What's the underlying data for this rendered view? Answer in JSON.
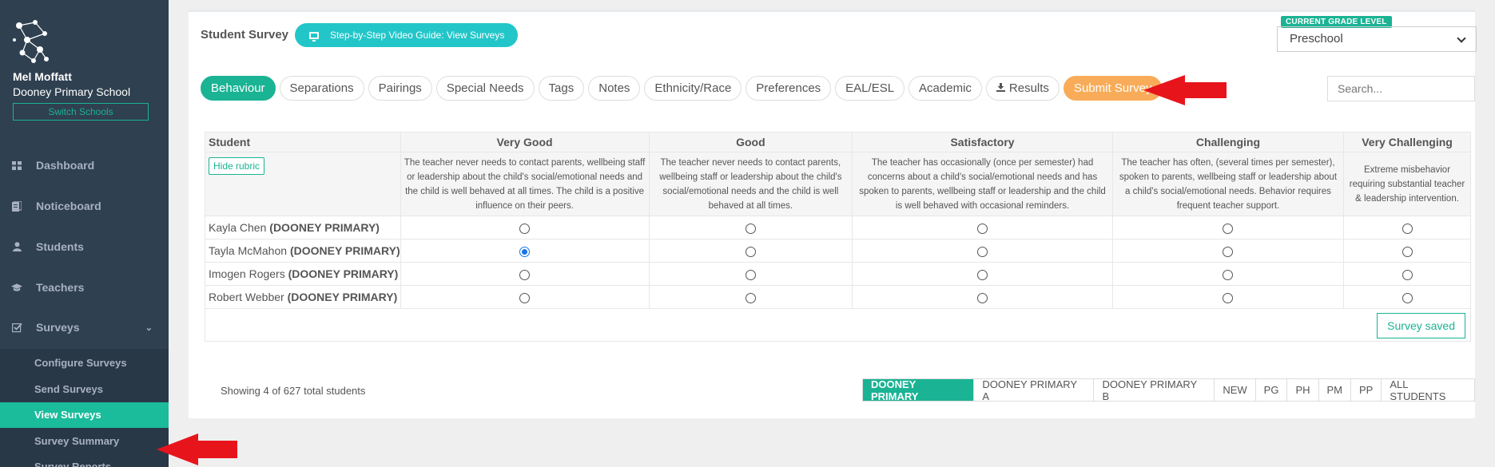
{
  "sidebar": {
    "user_name": "Mel Moffatt",
    "school_name": "Dooney Primary School",
    "switch_label": "Switch Schools",
    "nav": [
      {
        "label": "Dashboard",
        "icon": "dashboard-icon"
      },
      {
        "label": "Noticeboard",
        "icon": "noticeboard-icon"
      },
      {
        "label": "Students",
        "icon": "user-icon"
      },
      {
        "label": "Teachers",
        "icon": "graduation-cap-icon"
      },
      {
        "label": "Surveys",
        "icon": "checkbox-icon"
      }
    ],
    "sub_nav": [
      {
        "label": "Configure Surveys"
      },
      {
        "label": "Send Surveys"
      },
      {
        "label": "View Surveys"
      },
      {
        "label": "Survey Summary"
      },
      {
        "label": "Survey Reports"
      }
    ]
  },
  "header": {
    "title": "Student Survey",
    "guide_label": "Step-by-Step Video Guide: View Surveys",
    "grade_badge": "CURRENT GRADE LEVEL",
    "grade_value": "Preschool"
  },
  "tabs": [
    "Behaviour",
    "Separations",
    "Pairings",
    "Special Needs",
    "Tags",
    "Notes",
    "Ethnicity/Race",
    "Preferences",
    "EAL/ESL",
    "Academic",
    "Results",
    "Submit Survey"
  ],
  "search": {
    "placeholder": "Search..."
  },
  "table": {
    "columns": [
      "Student",
      "Very Good",
      "Good",
      "Satisfactory",
      "Challenging",
      "Very Challenging"
    ],
    "hide_rubric_label": "Hide rubric",
    "rubric": [
      "The teacher never needs to contact parents, wellbeing staff or leadership about the child's social/emotional needs and the child is well behaved at all times. The child is a positive influence on their peers.",
      "The teacher never needs to contact parents, wellbeing staff or leadership about the child's social/emotional needs and the child is well behaved at all times.",
      "The teacher has occasionally (once per semester) had concerns about a child's social/emotional needs and has spoken to parents, wellbeing staff or leadership and the child is well behaved with occasional reminders.",
      "The teacher has often, (several times per semester), spoken to parents, wellbeing staff or leadership about a child's social/emotional needs. Behavior requires frequent teacher support.",
      "Extreme misbehavior requiring substantial teacher & leadership intervention."
    ],
    "rows": [
      {
        "name": "Kayla Chen",
        "school": "(DOONEY PRIMARY)",
        "selected": null
      },
      {
        "name": "Tayla McMahon",
        "school": "(DOONEY PRIMARY)",
        "selected": 0
      },
      {
        "name": "Imogen Rogers",
        "school": "(DOONEY PRIMARY)",
        "selected": null
      },
      {
        "name": "Robert Webber",
        "school": "(DOONEY PRIMARY)",
        "selected": null
      }
    ],
    "saved_label": "Survey saved"
  },
  "footer": {
    "showing": "Showing 4 of 627 total students",
    "filters": [
      "DOONEY PRIMARY",
      "DOONEY PRIMARY A",
      "DOONEY PRIMARY B",
      "NEW",
      "PG",
      "PH",
      "PM",
      "PP",
      "ALL STUDENTS"
    ]
  },
  "colors": {
    "sidebar": "#2f4050",
    "accent": "#1ab394",
    "submit": "#f8ac59",
    "annotation_arrow": "#e8141c"
  }
}
